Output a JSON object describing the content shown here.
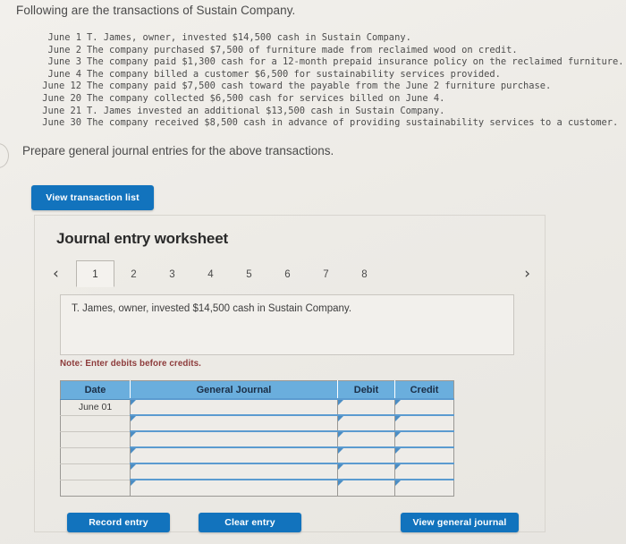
{
  "intro": "Following are the transactions of Sustain Company.",
  "transactions": [
    {
      "date": "June 1",
      "text": "T. James, owner, invested $14,500 cash in Sustain Company."
    },
    {
      "date": "June 2",
      "text": "The company purchased $7,500 of furniture made from reclaimed wood on credit."
    },
    {
      "date": "June 3",
      "text": "The company paid $1,300 cash for a 12-month prepaid insurance policy on the reclaimed furniture."
    },
    {
      "date": "June 4",
      "text": "The company billed a customer $6,500 for sustainability services provided."
    },
    {
      "date": "June 12",
      "text": "The company paid $7,500 cash toward the payable from the June 2 furniture purchase."
    },
    {
      "date": "June 20",
      "text": "The company collected $6,500 cash for services billed on June 4."
    },
    {
      "date": "June 21",
      "text": "T. James invested an additional $13,500 cash in Sustain Company."
    },
    {
      "date": "June 30",
      "text": "The company received $8,500 cash in advance of providing sustainability services to a customer."
    }
  ],
  "prompt": "Prepare general journal entries for the above transactions.",
  "buttons": {
    "view_transaction_list": "View transaction list",
    "record_entry": "Record entry",
    "clear_entry": "Clear entry",
    "view_general_journal": "View general journal"
  },
  "worksheet": {
    "title": "Journal entry worksheet",
    "nav": {
      "prev": "‹",
      "next": "›"
    },
    "tabs": [
      {
        "label": "1",
        "active": true
      },
      {
        "label": "2",
        "active": false
      },
      {
        "label": "3",
        "active": false
      },
      {
        "label": "4",
        "active": false
      },
      {
        "label": "5",
        "active": false
      },
      {
        "label": "6",
        "active": false
      },
      {
        "label": "7",
        "active": false
      },
      {
        "label": "8",
        "active": false
      }
    ],
    "active_tab": "1",
    "description": "T. James, owner, invested $14,500 cash in Sustain Company.",
    "note": "Note: Enter debits before credits.",
    "table": {
      "headers": [
        "Date",
        "General Journal",
        "Debit",
        "Credit"
      ],
      "rows": [
        {
          "date": "June 01",
          "general_journal": "",
          "debit": "",
          "credit": ""
        },
        {
          "date": "",
          "general_journal": "",
          "debit": "",
          "credit": ""
        },
        {
          "date": "",
          "general_journal": "",
          "debit": "",
          "credit": ""
        },
        {
          "date": "",
          "general_journal": "",
          "debit": "",
          "credit": ""
        },
        {
          "date": "",
          "general_journal": "",
          "debit": "",
          "credit": ""
        },
        {
          "date": "",
          "general_journal": "",
          "debit": "",
          "credit": ""
        }
      ]
    }
  },
  "colors": {
    "button_blue": "#1273bd",
    "table_header_blue": "#6aaedd",
    "note_red": "#8d3b3b",
    "page_bg": "#eceae5"
  }
}
